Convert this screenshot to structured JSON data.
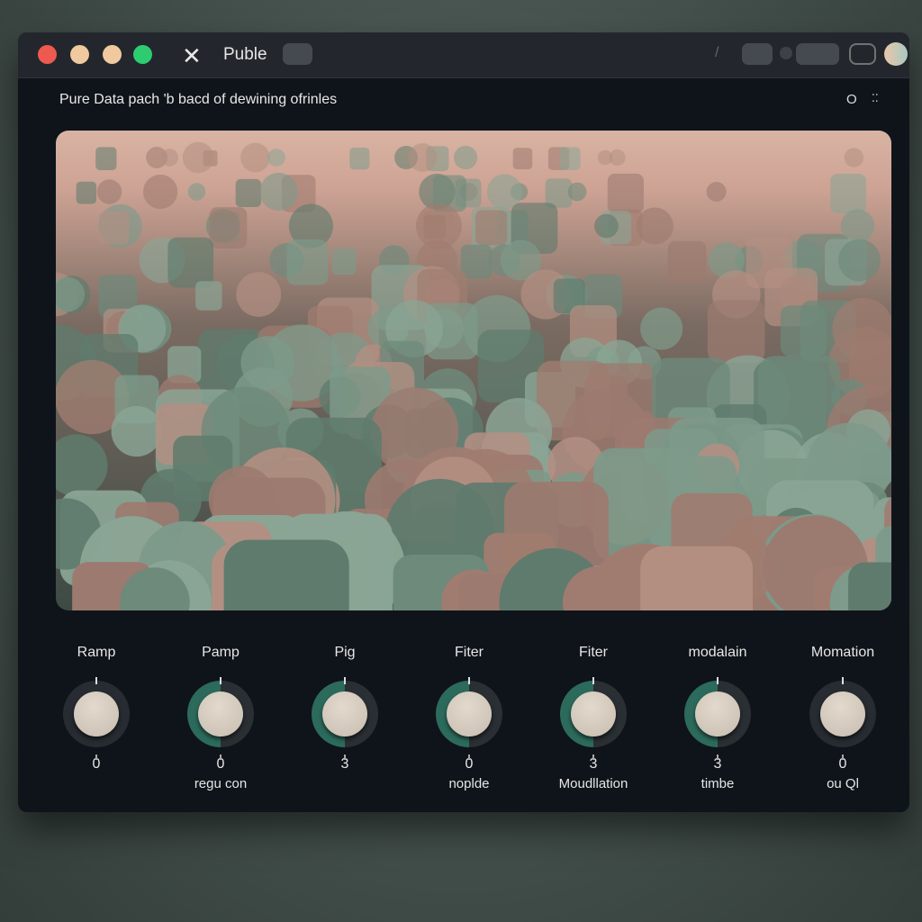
{
  "window": {
    "title": "Puble",
    "subtitle": "Pure Data pach 'b bacd of dewining ofrinles",
    "header_icons": [
      "circle-icon",
      "sparkle-icon"
    ]
  },
  "titlebar": {
    "dots": [
      "#ee5a50",
      "#f0c99e",
      "#f0c99e",
      "#2ecc71"
    ],
    "close_icon": "✕",
    "header_circle": "O",
    "header_sparkle": "⁚⁚"
  },
  "knobs": [
    {
      "label": "Ramp",
      "value": "0",
      "sublabel": "",
      "active": false
    },
    {
      "label": "Pamp",
      "value": "0",
      "sublabel": "regu con",
      "active": true
    },
    {
      "label": "Pig",
      "value": "3",
      "sublabel": "",
      "active": true
    },
    {
      "label": "Fiter",
      "value": "0",
      "sublabel": "noplde",
      "active": true
    },
    {
      "label": "Fiter",
      "value": "3",
      "sublabel": "Moudllation",
      "active": true
    },
    {
      "label": "modalain",
      "value": "3",
      "sublabel": "timbe",
      "active": true
    },
    {
      "label": "Momation",
      "value": "0",
      "sublabel": "ou Ql",
      "active": false
    }
  ],
  "colors": {
    "accent": "#2c6b5c",
    "knob_cap": "#d6cdc1",
    "panel": "#0f141a"
  }
}
